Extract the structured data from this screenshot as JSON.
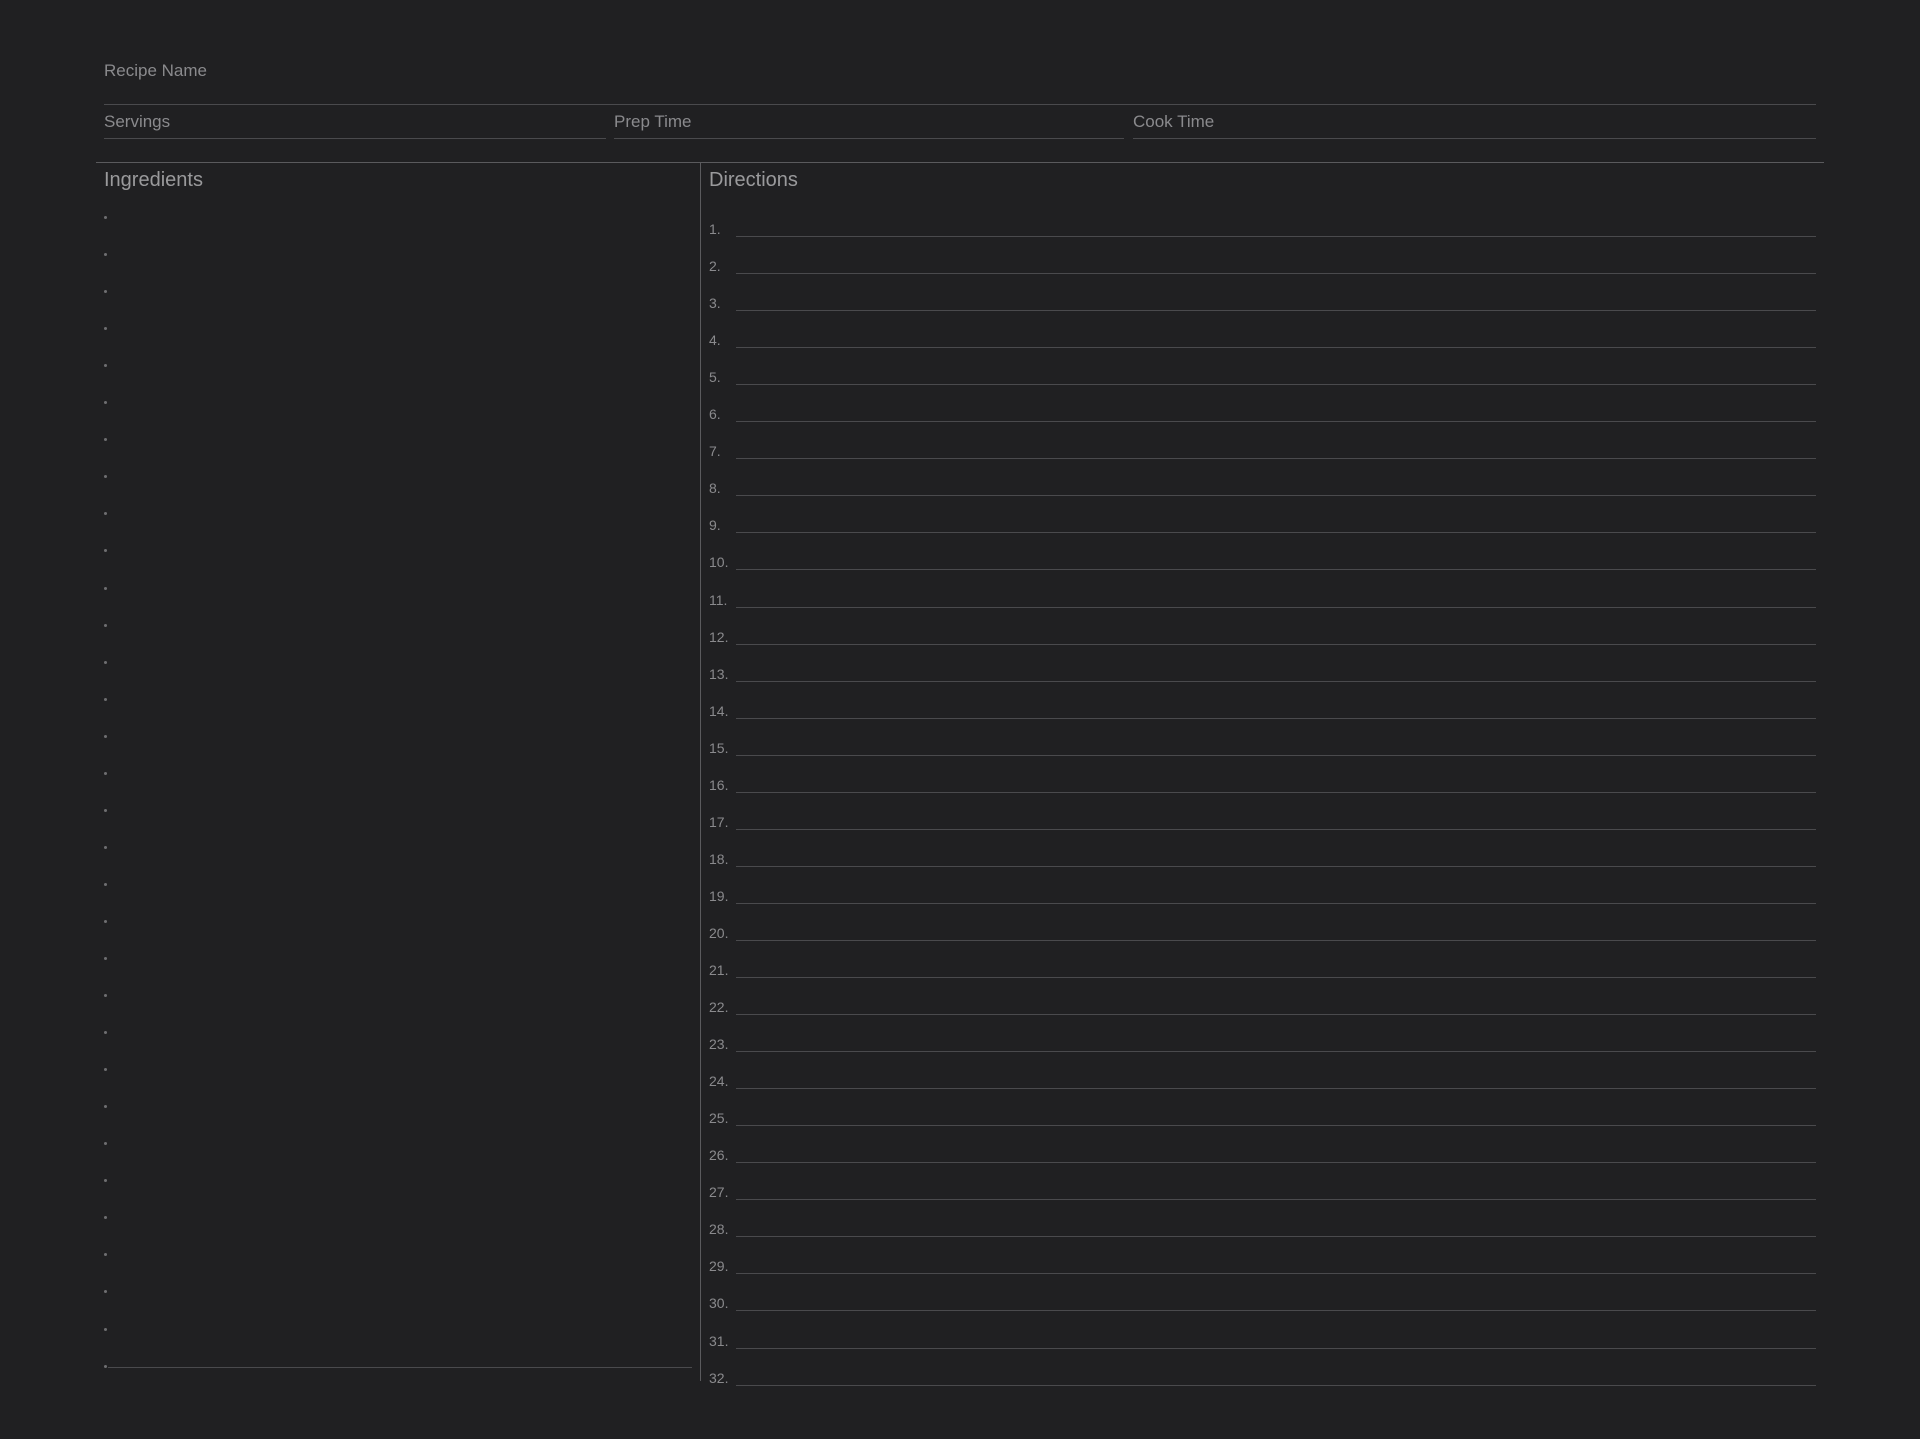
{
  "header": {
    "recipe_name_label": "Recipe Name",
    "servings_label": "Servings",
    "prep_time_label": "Prep Time",
    "cook_time_label": "Cook Time"
  },
  "ingredients": {
    "title": "Ingredients",
    "bullet_count": 32
  },
  "directions": {
    "title": "Directions",
    "steps": [
      "1.",
      "2.",
      "3.",
      "4.",
      "5.",
      "6.",
      "7.",
      "8.",
      "9.",
      "10.",
      "11.",
      "12.",
      "13.",
      "14.",
      "15.",
      "16.",
      "17.",
      "18.",
      "19.",
      "20.",
      "21.",
      "22.",
      "23.",
      "24.",
      "25.",
      "26.",
      "27.",
      "28.",
      "29.",
      "30.",
      "31.",
      "32."
    ]
  }
}
